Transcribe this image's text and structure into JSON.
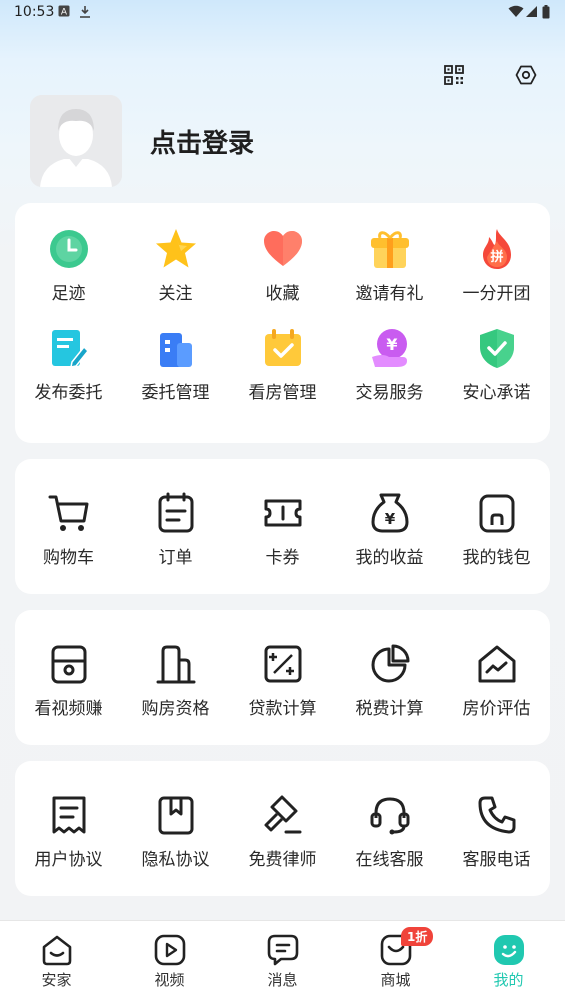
{
  "status_bar": {
    "time": "10:53"
  },
  "header": {
    "login_label": "点击登录",
    "qr_icon": "qr-code-icon",
    "settings_icon": "settings-icon"
  },
  "services": {
    "row1": [
      {
        "label": "足迹",
        "icon": "clock-icon"
      },
      {
        "label": "关注",
        "icon": "star-icon"
      },
      {
        "label": "收藏",
        "icon": "heart-icon"
      },
      {
        "label": "邀请有礼",
        "icon": "gift-icon"
      },
      {
        "label": "一分开团",
        "icon": "flame-icon",
        "icon_text": "拼"
      }
    ],
    "row2": [
      {
        "label": "发布委托",
        "icon": "edit-doc-icon"
      },
      {
        "label": "委托管理",
        "icon": "building-icon"
      },
      {
        "label": "看房管理",
        "icon": "calendar-check-icon"
      },
      {
        "label": "交易服务",
        "icon": "yuan-coin-icon",
        "icon_text": "¥"
      },
      {
        "label": "安心承诺",
        "icon": "shield-check-icon"
      }
    ]
  },
  "wallet": [
    {
      "label": "购物车",
      "icon": "cart-icon"
    },
    {
      "label": "订单",
      "icon": "order-list-icon"
    },
    {
      "label": "卡券",
      "icon": "ticket-icon"
    },
    {
      "label": "我的收益",
      "icon": "money-bag-icon",
      "icon_text": "¥"
    },
    {
      "label": "我的钱包",
      "icon": "wallet-icon"
    }
  ],
  "tools": [
    {
      "label": "看视频赚",
      "icon": "video-earn-icon"
    },
    {
      "label": "购房资格",
      "icon": "building-outline-icon"
    },
    {
      "label": "贷款计算",
      "icon": "calculator-icon"
    },
    {
      "label": "税费计算",
      "icon": "pie-chart-icon"
    },
    {
      "label": "房价评估",
      "icon": "house-trend-icon"
    }
  ],
  "support": [
    {
      "label": "用户协议",
      "icon": "receipt-icon"
    },
    {
      "label": "隐私协议",
      "icon": "bookmark-doc-icon"
    },
    {
      "label": "免费律师",
      "icon": "gavel-icon"
    },
    {
      "label": "在线客服",
      "icon": "headset-icon"
    },
    {
      "label": "客服电话",
      "icon": "phone-icon"
    }
  ],
  "bottom_nav": [
    {
      "label": "安家",
      "icon": "home-smile-icon"
    },
    {
      "label": "视频",
      "icon": "play-icon"
    },
    {
      "label": "消息",
      "icon": "message-icon"
    },
    {
      "label": "商城",
      "icon": "shop-icon",
      "badge": "1折"
    },
    {
      "label": "我的",
      "icon": "profile-face-icon",
      "active": true
    }
  ],
  "colors": {
    "accent": "#20c8b0",
    "badge": "#f0433a"
  }
}
